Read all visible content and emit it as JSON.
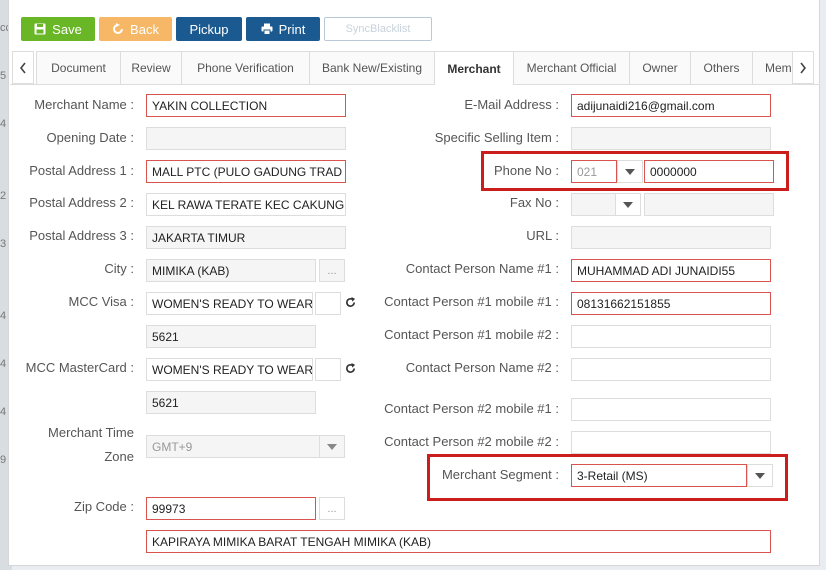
{
  "background": {
    "row_markers": [
      "cc",
      "5",
      "4",
      "2",
      "3",
      "4",
      "4",
      "4",
      "9"
    ]
  },
  "toolbar": {
    "save_label": "Save",
    "back_label": "Back",
    "pickup_label": "Pickup",
    "print_label": "Print",
    "sync_label": "SyncBlacklist"
  },
  "tabs": [
    {
      "label": "Document",
      "active": false
    },
    {
      "label": "Review",
      "active": false
    },
    {
      "label": "Phone Verification",
      "active": false
    },
    {
      "label": "Bank New/Existing",
      "active": false
    },
    {
      "label": "Merchant",
      "active": true
    },
    {
      "label": "Merchant Official",
      "active": false
    },
    {
      "label": "Owner",
      "active": false
    },
    {
      "label": "Others",
      "active": false
    },
    {
      "label": "Mem",
      "active": false
    }
  ],
  "left": {
    "merchant_name": {
      "label": "Merchant Name :",
      "value": "YAKIN COLLECTION"
    },
    "opening_date": {
      "label": "Opening Date :",
      "value": ""
    },
    "postal_address_1": {
      "label": "Postal Address 1 :",
      "value": "MALL PTC (PULO GADUNG TRAD"
    },
    "postal_address_2": {
      "label": "Postal Address 2 :",
      "value": "KEL RAWA TERATE KEC CAKUNG"
    },
    "postal_address_3": {
      "label": "Postal Address 3 :",
      "value": "JAKARTA TIMUR"
    },
    "city": {
      "label": "City :",
      "value": "MIMIKA (KAB)",
      "button": "..."
    },
    "mcc_visa": {
      "label": "MCC Visa :",
      "value": "WOMEN'S READY TO WEAR",
      "code": "5621"
    },
    "mcc_mastercard": {
      "label": "MCC MasterCard :",
      "value": "WOMEN'S READY TO WEAR",
      "code": "5621"
    },
    "merchant_time_zone": {
      "label_line1": "Merchant Time",
      "label_line2": "Zone",
      "value": "GMT+9"
    },
    "zip_code": {
      "label": "Zip Code :",
      "value": "99973",
      "button": "..."
    },
    "area": {
      "value": "KAPIRAYA MIMIKA BARAT TENGAH MIMIKA (KAB)"
    }
  },
  "right": {
    "email": {
      "label": "E-Mail Address :",
      "value": "adijunaidi216@gmail.com"
    },
    "specific_selling_item": {
      "label": "Specific Selling Item :",
      "value": ""
    },
    "phone_no": {
      "label": "Phone No :",
      "area_code": "021",
      "number": "0000000"
    },
    "fax_no": {
      "label": "Fax No :",
      "area_code": "",
      "number": ""
    },
    "url": {
      "label": "URL :",
      "value": ""
    },
    "contact_person_name_1": {
      "label": "Contact Person Name #1 :",
      "value": "MUHAMMAD ADI JUNAIDI55"
    },
    "contact_person_1_mobile_1": {
      "label": "Contact Person #1 mobile #1 :",
      "value": "08131662151855"
    },
    "contact_person_1_mobile_2": {
      "label": "Contact Person #1 mobile #2 :",
      "value": ""
    },
    "contact_person_name_2": {
      "label": "Contact Person Name #2 :",
      "value": ""
    },
    "contact_person_2_mobile_1": {
      "label": "Contact Person #2 mobile #1 :",
      "value": ""
    },
    "contact_person_2_mobile_2": {
      "label": "Contact Person #2 mobile #2 :",
      "value": ""
    },
    "merchant_segment": {
      "label": "Merchant Segment :",
      "value": "3-Retail (MS)"
    }
  },
  "colors": {
    "save": "#69b626",
    "back": "#f6b867",
    "primary": "#1b5a91",
    "required_border": "#d9534f",
    "highlight": "#cc1d1d"
  }
}
